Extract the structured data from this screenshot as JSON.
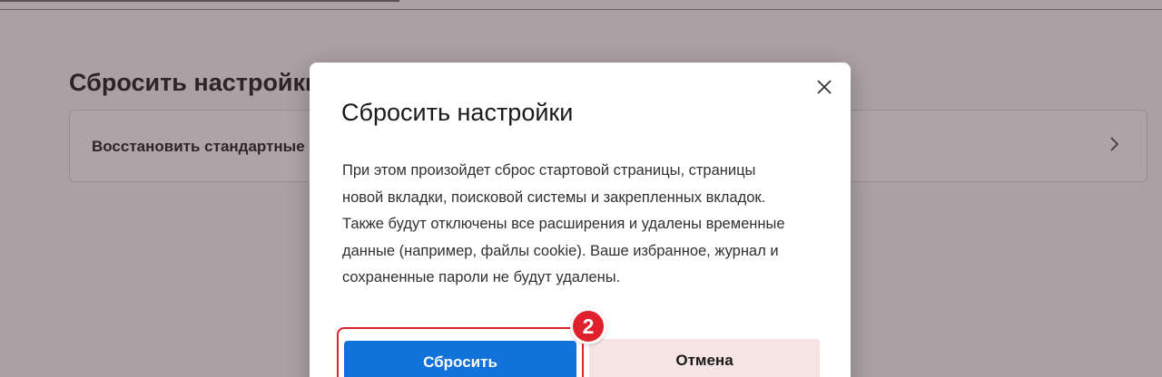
{
  "page": {
    "section_title": "Сбросить настройки",
    "reset_row_label": "Восстановить стандартные значения"
  },
  "dialog": {
    "title": "Сбросить настройки",
    "body": "При этом произойдет сброс стартовой страницы, страницы новой вкладки, поисковой системы и закрепленных вкладок. Также будут отключены все расширения и удалены временные данные (например, файлы cookie). Ваше избранное, журнал и сохраненные пароли не будут удалены.",
    "reset_label": "Сбросить",
    "cancel_label": "Отмена",
    "close_icon": "close-icon"
  },
  "annotation": {
    "step_number": "2",
    "highlight_color": "#e0202c"
  },
  "colors": {
    "primary_button": "#1172db",
    "cancel_button": "#f6e3e4"
  }
}
